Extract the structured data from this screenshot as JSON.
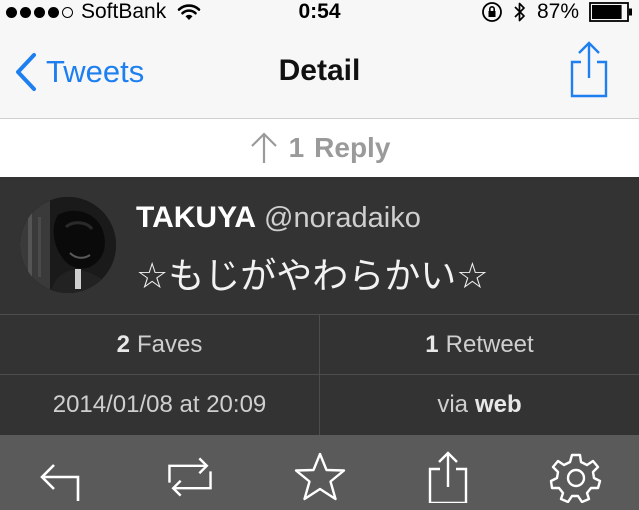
{
  "status_bar": {
    "carrier": "SoftBank",
    "time": "0:54",
    "battery": "87%",
    "battery_level": 0.87,
    "signal_bars": 4,
    "signal_total": 5
  },
  "nav": {
    "back_label": "Tweets",
    "title": "Detail"
  },
  "reply": {
    "count": "1",
    "label": "Reply"
  },
  "tweet": {
    "name": "TAKUYA",
    "handle": "@noradaiko",
    "text": "☆もじがやわらかい☆"
  },
  "stats": {
    "faves_count": "2",
    "faves_label": "Faves",
    "retweets_count": "1",
    "retweets_label": "Retweet"
  },
  "meta": {
    "date": "2014/01/08 at 20:09",
    "via_prefix": "via",
    "via_source": "web"
  },
  "toolbar": {
    "icons": [
      "reply-icon",
      "retweet-icon",
      "favorite-icon",
      "share-icon",
      "settings-icon"
    ]
  },
  "colors": {
    "accent": "#1e7ff0",
    "tweet_background": "#333333",
    "toolbar_background": "#5a5a5a"
  }
}
